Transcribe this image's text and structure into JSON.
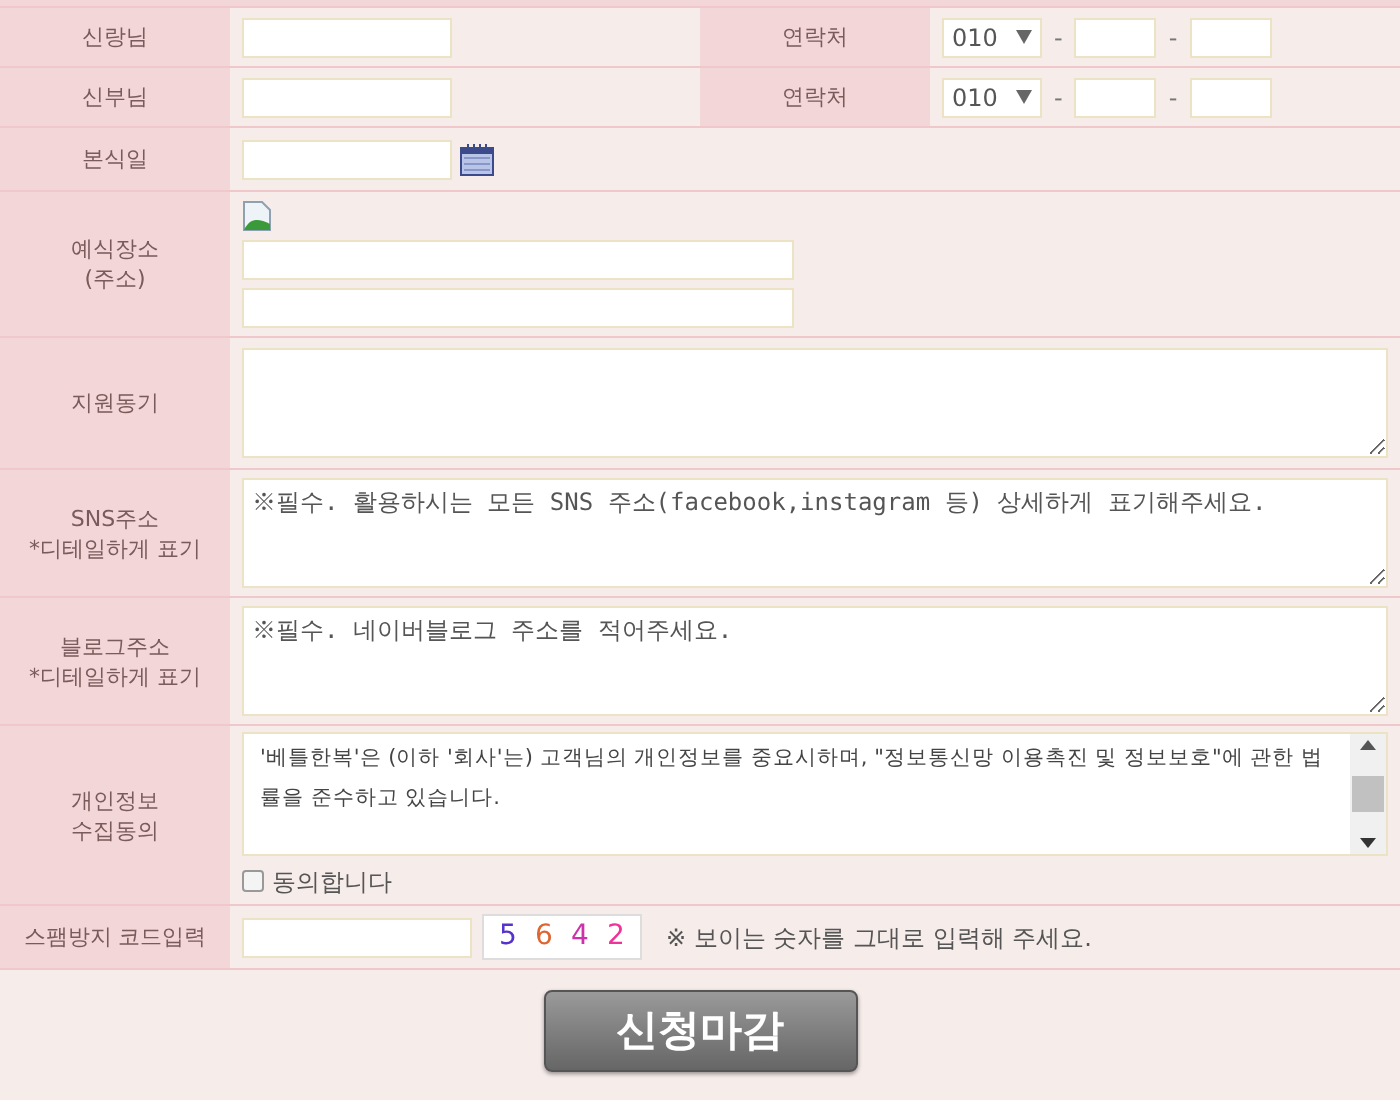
{
  "rows": [
    {
      "kind": "pair",
      "label": "신랑님",
      "contact_label": "연락처",
      "phone_prefix": "010",
      "dash_1": "-",
      "dash_2": "-"
    },
    {
      "kind": "pair",
      "label": "신부님",
      "contact_label": "연락처",
      "phone_prefix": "010",
      "dash_1": "-",
      "dash_2": "-"
    },
    {
      "kind": "date",
      "label": "본식일"
    },
    {
      "kind": "address",
      "label": "예식장소\n(주소)"
    },
    {
      "kind": "textarea",
      "label": "지원동기",
      "value": ""
    },
    {
      "kind": "textarea",
      "label": "SNS주소\n*디테일하게 표기",
      "value": "※필수. 활용하시는 모든 SNS 주소(facebook,instagram 등) 상세하게 표기해주세요."
    },
    {
      "kind": "textarea",
      "label": "블로그주소\n*디테일하게 표기",
      "value": "※필수. 네이버블로그 주소를 적어주세요."
    },
    {
      "kind": "terms",
      "label": "개인정보\n수집동의",
      "terms": "'베틀한복'은 (이하 '회사'는) 고객님의 개인정보를 중요시하며, \"정보통신망 이용촉진 및 정보보호\"에 관한 법률을 준수하고 있습니다.",
      "agree_label": "동의합니다",
      "agree_checked": false
    },
    {
      "kind": "captcha",
      "label": "스팸방지 코드입력",
      "digits": [
        {
          "text": "5",
          "color": "#5533cc"
        },
        {
          "text": "6",
          "color": "#dd6633"
        },
        {
          "text": "4",
          "color": "#cc33aa"
        },
        {
          "text": "2",
          "color": "#ee3399"
        }
      ],
      "hint": "※ 보이는 숫자를 그대로 입력해 주세요."
    }
  ],
  "submit": "신청마감"
}
